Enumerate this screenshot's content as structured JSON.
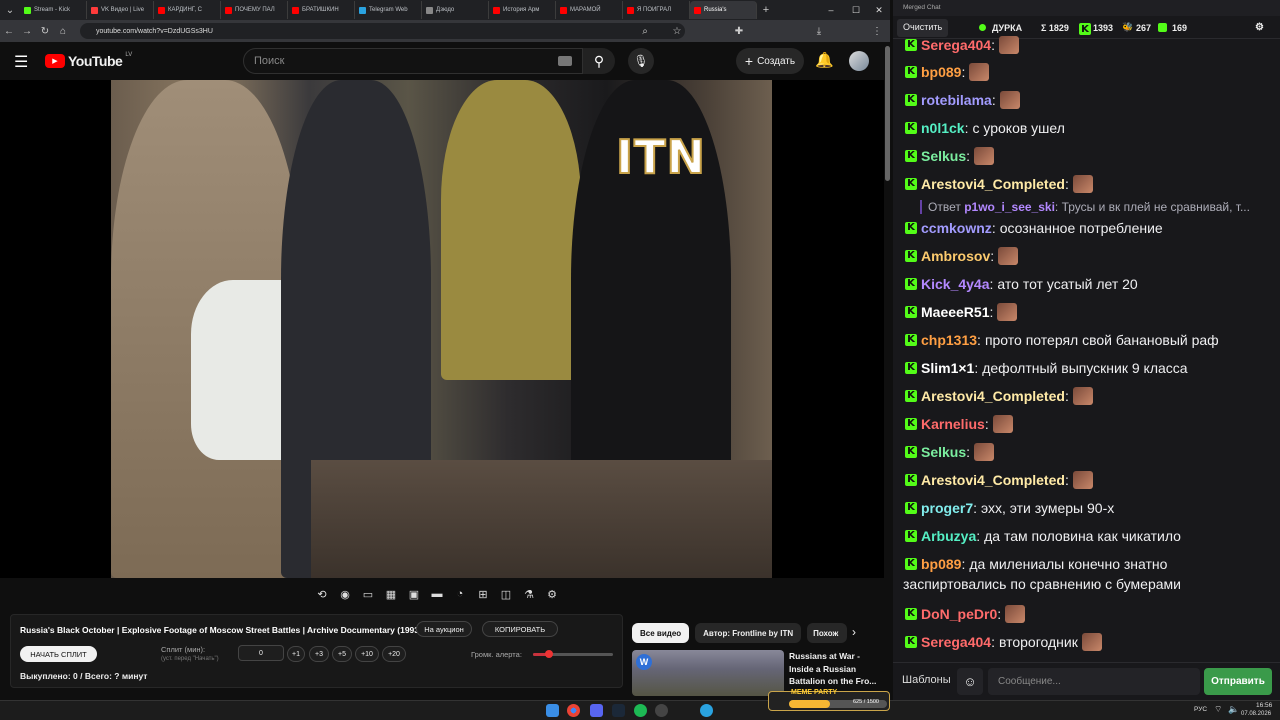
{
  "browser": {
    "tabs": [
      {
        "label": "Stream - Kick",
        "color": "#53fc18"
      },
      {
        "label": "VK Видео | Live",
        "color": "#ff3b3b"
      },
      {
        "label": "КАРДИНГ, С",
        "color": "#ff0000"
      },
      {
        "label": "ПОЧЕМУ ПАЛ",
        "color": "#ff0000"
      },
      {
        "label": "БРАТИШКИН",
        "color": "#ff0000"
      },
      {
        "label": "Telegram Web",
        "color": "#2aa3e0"
      },
      {
        "label": "Дзюдо",
        "color": "#888888"
      },
      {
        "label": "История Арм",
        "color": "#ff0000"
      },
      {
        "label": "МАРАМОЙ",
        "color": "#ff0000"
      },
      {
        "label": "Я ПОИГРАЛ",
        "color": "#ff0000"
      },
      {
        "label": "Russia's",
        "color": "#ff0000",
        "active": true
      }
    ],
    "url": "youtube.com/watch?v=DzdUGSs3HU"
  },
  "youtube": {
    "logo": "YouTube",
    "region": "LV",
    "search_placeholder": "Поиск",
    "create_label": "Создать",
    "overlay_text": "ITN"
  },
  "extension": {
    "video_title": "Russia's Black October | Explosive Footage of Moscow Street Battles | Archive Documentary (1993)",
    "auction_label": "На аукцион",
    "copy_label": "КОПИРОВАТЬ",
    "start_split_label": "НАЧАТЬ СПЛИТ",
    "split_label": "Сплит (мин):",
    "split_hint": "(уст. перед \"Начать\")",
    "split_value": "0",
    "increments": [
      "+1",
      "+3",
      "+5",
      "+10",
      "+20"
    ],
    "volume_label": "Громк. алерта:",
    "volume_level": 0.2,
    "status": "Выкуплено: 0 / Всего: ? минут"
  },
  "related": {
    "chips": [
      "Все видео",
      "Автор: Frontline by ITN",
      "Похож"
    ],
    "video_title": "Russians at War - Inside a Russian Battalion on the Fro..."
  },
  "chat": {
    "window_title": "Merged Chat",
    "clear_label": "Очистить",
    "channel": "ДУРКА",
    "total": "Σ 1829",
    "kick_count": "1393",
    "vk_count": "267",
    "other_count": "169",
    "messages": [
      {
        "user": "Serega404",
        "text": "",
        "color": "#ff6b6b",
        "emote": true
      },
      {
        "user": "bp089",
        "text": "",
        "color": "#ff9f43",
        "emote": true
      },
      {
        "user": "rotebilama",
        "text": "",
        "color": "#a29bfe",
        "emote": true
      },
      {
        "user": "n0l1ck",
        "text": "с уроков ушел",
        "color": "#55efc4",
        "emote": false
      },
      {
        "user": "Selkus",
        "text": "",
        "color": "#7bed9f",
        "emote": true
      },
      {
        "user": "Arestovi4_Completed",
        "text": "",
        "color": "#ffeaa7",
        "emote": true
      },
      {
        "user": "ccmkownz",
        "text": "осознанное потребление",
        "color": "#a29bfe",
        "emote": false
      },
      {
        "user": "Ambrosov",
        "text": "",
        "color": "#fdcb6e",
        "emote": true
      },
      {
        "user": "Kick_4y4a",
        "text": "ато тот усатый лет 20",
        "color": "#b388ff",
        "emote": false
      },
      {
        "user": "MaeeeR51",
        "text": "",
        "color": "#ffffff",
        "emote": true
      },
      {
        "user": "chp1313",
        "text": "прото потерял свой банановый раф",
        "color": "#ff9f43",
        "emote": false
      },
      {
        "user": "Slim1×1",
        "text": "дефолтный выпускник 9 класса",
        "color": "#ffffff",
        "emote": false
      },
      {
        "user": "Arestovi4_Completed",
        "text": "",
        "color": "#ffeaa7",
        "emote": true
      },
      {
        "user": "Karnelius",
        "text": "",
        "color": "#ff6b6b",
        "emote": true
      },
      {
        "user": "Selkus",
        "text": "",
        "color": "#7bed9f",
        "emote": true
      },
      {
        "user": "Arestovi4_Completed",
        "text": "",
        "color": "#ffeaa7",
        "emote": true
      },
      {
        "user": "proger7",
        "text": "эхх, эти зумеры 90-х",
        "color": "#81ecec",
        "emote": false
      },
      {
        "user": "Arbuzya",
        "text": "да там половина как чикатило",
        "color": "#55efc4",
        "emote": false
      },
      {
        "user": "bp089",
        "text": "да милениалы конечно знатно",
        "color": "#ff9f43",
        "emote": false
      },
      {
        "user": "DoN_peDr0",
        "text": "",
        "color": "#ff6b6b",
        "emote": true
      },
      {
        "user": "Serega404",
        "text": "второгодник",
        "color": "#ff6b6b",
        "emote": true
      }
    ],
    "continuation": "заспиртовались по сравнению с бумерами",
    "reply_prefix": "Ответ",
    "reply_user": "p1wo_i_see_ski",
    "reply_text": "Трусы и вк плей не сравнивай, т...",
    "templates_label": "Шаблоны",
    "message_placeholder": "Сообщение...",
    "send_label": "Отправить"
  },
  "taskbar": {
    "lang": "РУС",
    "time": "16:56",
    "date": "07.08.2026",
    "meme_label": "MEME PARTY",
    "meme_progress": "625 / 1500"
  }
}
